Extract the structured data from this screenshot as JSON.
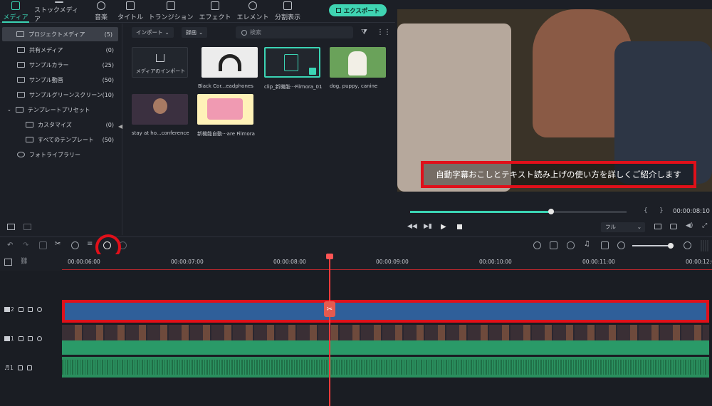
{
  "tabs": [
    {
      "label": "メディア",
      "active": true
    },
    {
      "label": "ストックメディア"
    },
    {
      "label": "音楽"
    },
    {
      "label": "タイトル"
    },
    {
      "label": "トランジション"
    },
    {
      "label": "エフェクト"
    },
    {
      "label": "エレメント"
    },
    {
      "label": "分割表示"
    }
  ],
  "export_label": "エクスポート",
  "sidebar": {
    "items": [
      {
        "label": "プロジェクトメディア",
        "count": "(5)"
      },
      {
        "label": "共有メディア",
        "count": "(0)"
      },
      {
        "label": "サンプルカラー",
        "count": "(25)"
      },
      {
        "label": "サンプル動画",
        "count": "(50)"
      },
      {
        "label": "サンプルグリーンスクリーン",
        "count": "(10)"
      },
      {
        "label": "テンプレートプリセット",
        "count": ""
      },
      {
        "label": "カスタマイズ",
        "count": "(0)"
      },
      {
        "label": "すべてのテンプレート",
        "count": "(50)"
      },
      {
        "label": "フォトライブラリー",
        "count": ""
      }
    ]
  },
  "media_toolbar": {
    "import_label": "インポート",
    "record_label": "録画",
    "search_placeholder": "検索"
  },
  "media_items": [
    {
      "label": "メディアのインポート"
    },
    {
      "label": "Black Cor...eadphones"
    },
    {
      "label": "clip_新機能···Filmora_01"
    },
    {
      "label": "dog, puppy, canine"
    },
    {
      "label": "stay at ho...conference"
    },
    {
      "label": "新機能自動···are Filmora"
    }
  ],
  "preview": {
    "subtitle": "自動字幕おこしとテキスト読み上げの使い方を詳しくご紹介します",
    "timecode": "00:00:08:10",
    "progress": 0.65,
    "quality": "フル"
  },
  "ruler": {
    "ticks": [
      "00:00:06:00",
      "00:00:07:00",
      "00:00:08:00",
      "00:00:09:00",
      "00:00:10:00",
      "00:00:11:00",
      "00:00:12:0"
    ]
  },
  "tracks": {
    "t2": "2",
    "t1": "1",
    "a1": "1"
  },
  "colors": {
    "accent": "#3bd4b4",
    "highlight": "#e0101a",
    "title_track": "#2f5f9a",
    "video_track": "#2a9a68",
    "playhead": "#ff3b3b"
  }
}
